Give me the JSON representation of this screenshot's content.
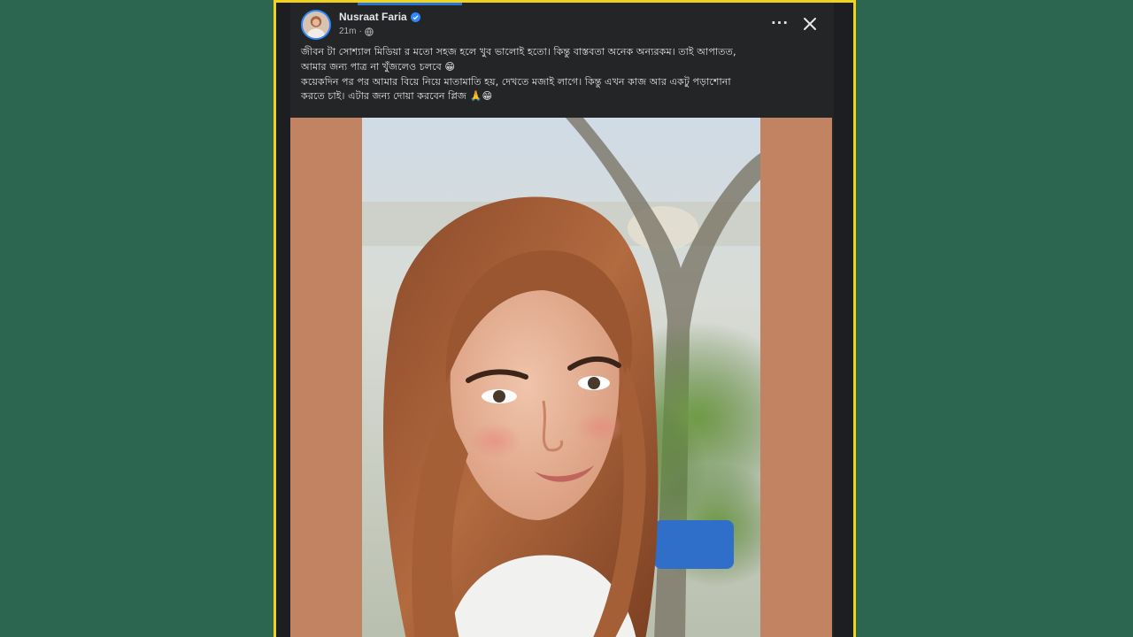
{
  "post": {
    "author": "Nusraat Faria",
    "verified_icon": "verified-badge-icon",
    "time": "21m",
    "separator": "·",
    "privacy_icon": "globe-icon",
    "more_label": "···",
    "close_icon": "close-icon",
    "text_lines": [
      "জীবন টা সোশ্যাল মিডিয়া র মতো সহজ হলে খুব ভালোই হতো। কিন্তু বাস্তবতা অনেক অন্যরকম। তাই আপাতত,",
      "আমার জন্য পাত্র না খুঁজলেও চলবে 😁",
      "কয়েকদিন পর পর আমার বিয়ে নিয়ে মাতামাতি হয়, দেখতে মজাই লাগে। কিন্তু এখন কাজ আর একটু পড়াশোনা",
      "করতে চাই। এটার জন্য দোয়া করবেন প্লিজ 🙏😁"
    ]
  },
  "colors": {
    "background": "#2c6650",
    "frame_border": "#f2d21b",
    "post_background": "#242526",
    "photo_side_panels": "#c28363",
    "accent": "#2d88ff"
  }
}
